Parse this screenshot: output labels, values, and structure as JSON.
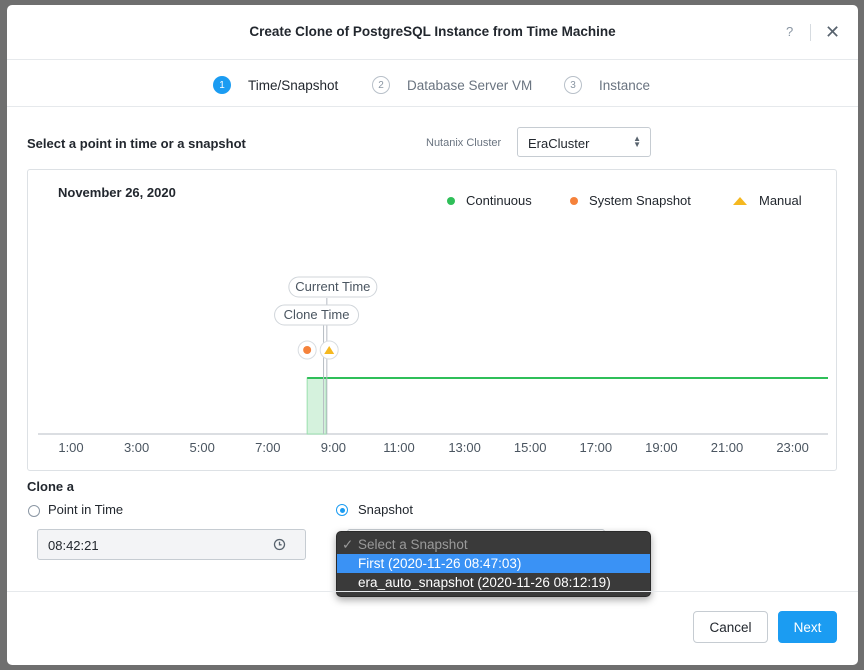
{
  "dialog": {
    "title": "Create Clone of PostgreSQL Instance from Time Machine",
    "help_label": "?",
    "close_label": "✕"
  },
  "steps": [
    {
      "number": "1",
      "label": "Time/Snapshot",
      "state": "active"
    },
    {
      "number": "2",
      "label": "Database Server VM",
      "state": "inactive"
    },
    {
      "number": "3",
      "label": "Instance",
      "state": "inactive"
    }
  ],
  "selection": {
    "heading": "Select a point in time or a snapshot",
    "cluster_label": "Nutanix Cluster",
    "cluster_value": "EraCluster"
  },
  "timeline": {
    "date": "November 26, 2020",
    "legend": [
      {
        "label": "Continuous",
        "color": "#2fbf59",
        "icon": "dot"
      },
      {
        "label": "System Snapshot",
        "color": "#f5823b",
        "icon": "dot"
      },
      {
        "label": "Manual",
        "color": "#f5b820",
        "icon": "triangle"
      }
    ],
    "markers": {
      "current_time_label": "Current Time",
      "clone_time_label": "Clone Time"
    }
  },
  "chart_data": {
    "type": "timeline",
    "x_unit": "hour of day",
    "xlim": [
      0.0,
      24.5
    ],
    "x_ticks": [
      1,
      3,
      5,
      7,
      9,
      11,
      13,
      15,
      17,
      19,
      21,
      23
    ],
    "tick_labels": [
      "1:00",
      "3:00",
      "5:00",
      "7:00",
      "9:00",
      "11:00",
      "13:00",
      "15:00",
      "17:00",
      "19:00",
      "21:00",
      "23:00"
    ],
    "continuous_range": [
      8.2,
      24.5
    ],
    "selected_range": [
      8.2,
      8.78
    ],
    "system_snapshots": [
      8.2
    ],
    "manual_snapshots": [
      8.78
    ],
    "current_time": 8.8,
    "clone_time": 8.7
  },
  "clone_from": {
    "heading": "Clone a",
    "point_in_time_label": "Point in Time",
    "snapshot_label": "Snapshot",
    "time_value": "08:42:21",
    "selected_mode": "snapshot"
  },
  "snapshot_dropdown": {
    "placeholder": "Select a Snapshot",
    "check": "✓",
    "options": [
      {
        "label": "First (2020-11-26 08:47:03)",
        "selected": true
      },
      {
        "label": "era_auto_snapshot (2020-11-26 08:12:19)",
        "selected": false
      }
    ]
  },
  "footer": {
    "cancel_label": "Cancel",
    "next_label": "Next"
  },
  "colors": {
    "accent": "#1b9cf2",
    "continuous": "#2fbf59",
    "system_snapshot": "#f5823b",
    "manual": "#f5b820",
    "dropdown_highlight": "#3a92f5"
  }
}
